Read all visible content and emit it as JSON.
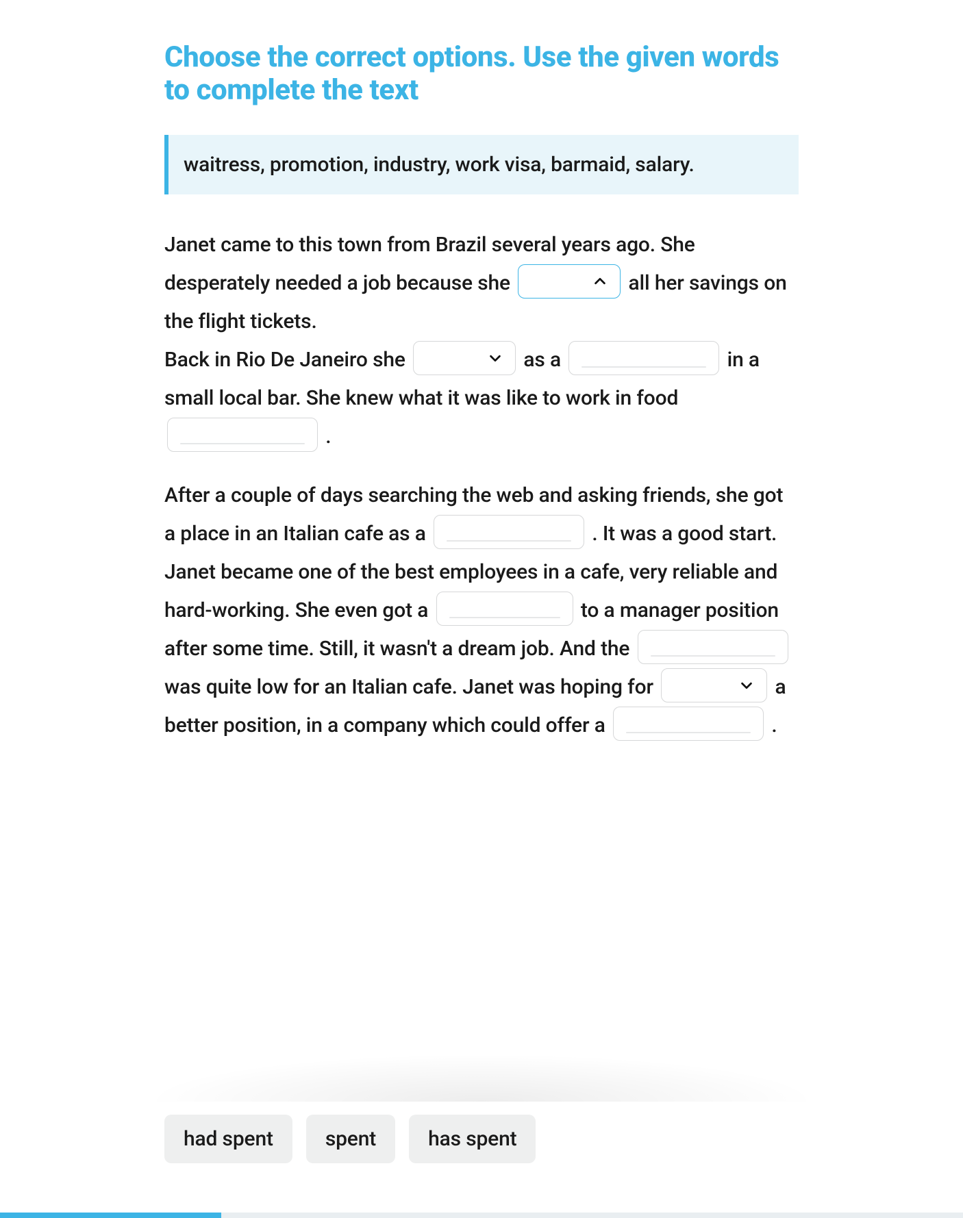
{
  "title": "Choose the correct options. Use the given words to complete the text",
  "wordbank": "waitress, promotion, industry, work visa, barmaid, salary.",
  "story": {
    "p1": {
      "s1": "Janet came to this town from Brazil several years ago. She desperately needed a job because she ",
      "s2": " all her savings on the flight tickets.",
      "s3": "Back in Rio De Janeiro she ",
      "s4": " as a ",
      "s5": " in a small local bar. She knew what it was like to work in food ",
      "s6": " ."
    },
    "p2": {
      "s1": "After a couple of days searching the web and asking friends, she got a place in an Italian cafe as a ",
      "s2": ". It was a good start. Janet became one of the best employees in a cafe, very reliable and hard-working. She even got a ",
      "s3": " to a manager position after some time. Still, it wasn't a dream job. And the ",
      "s4": " was quite low for an Italian cafe. Janet was hoping for ",
      "s5": " a better position, in a company which could offer a ",
      "s6": "."
    }
  },
  "gaps": {
    "g1": {
      "type": "select",
      "state": "open",
      "value": ""
    },
    "g2": {
      "type": "select",
      "state": "closed",
      "value": ""
    },
    "g3": {
      "type": "text",
      "value": ""
    },
    "g4": {
      "type": "text",
      "value": ""
    },
    "g5": {
      "type": "text",
      "value": ""
    },
    "g6": {
      "type": "text",
      "value": ""
    },
    "g7": {
      "type": "text",
      "value": ""
    },
    "g8": {
      "type": "select",
      "state": "closed",
      "value": ""
    },
    "g9": {
      "type": "text",
      "value": ""
    }
  },
  "options_for_open_gap": [
    "had spent",
    "spent",
    "has spent"
  ],
  "progress_percent": 23
}
